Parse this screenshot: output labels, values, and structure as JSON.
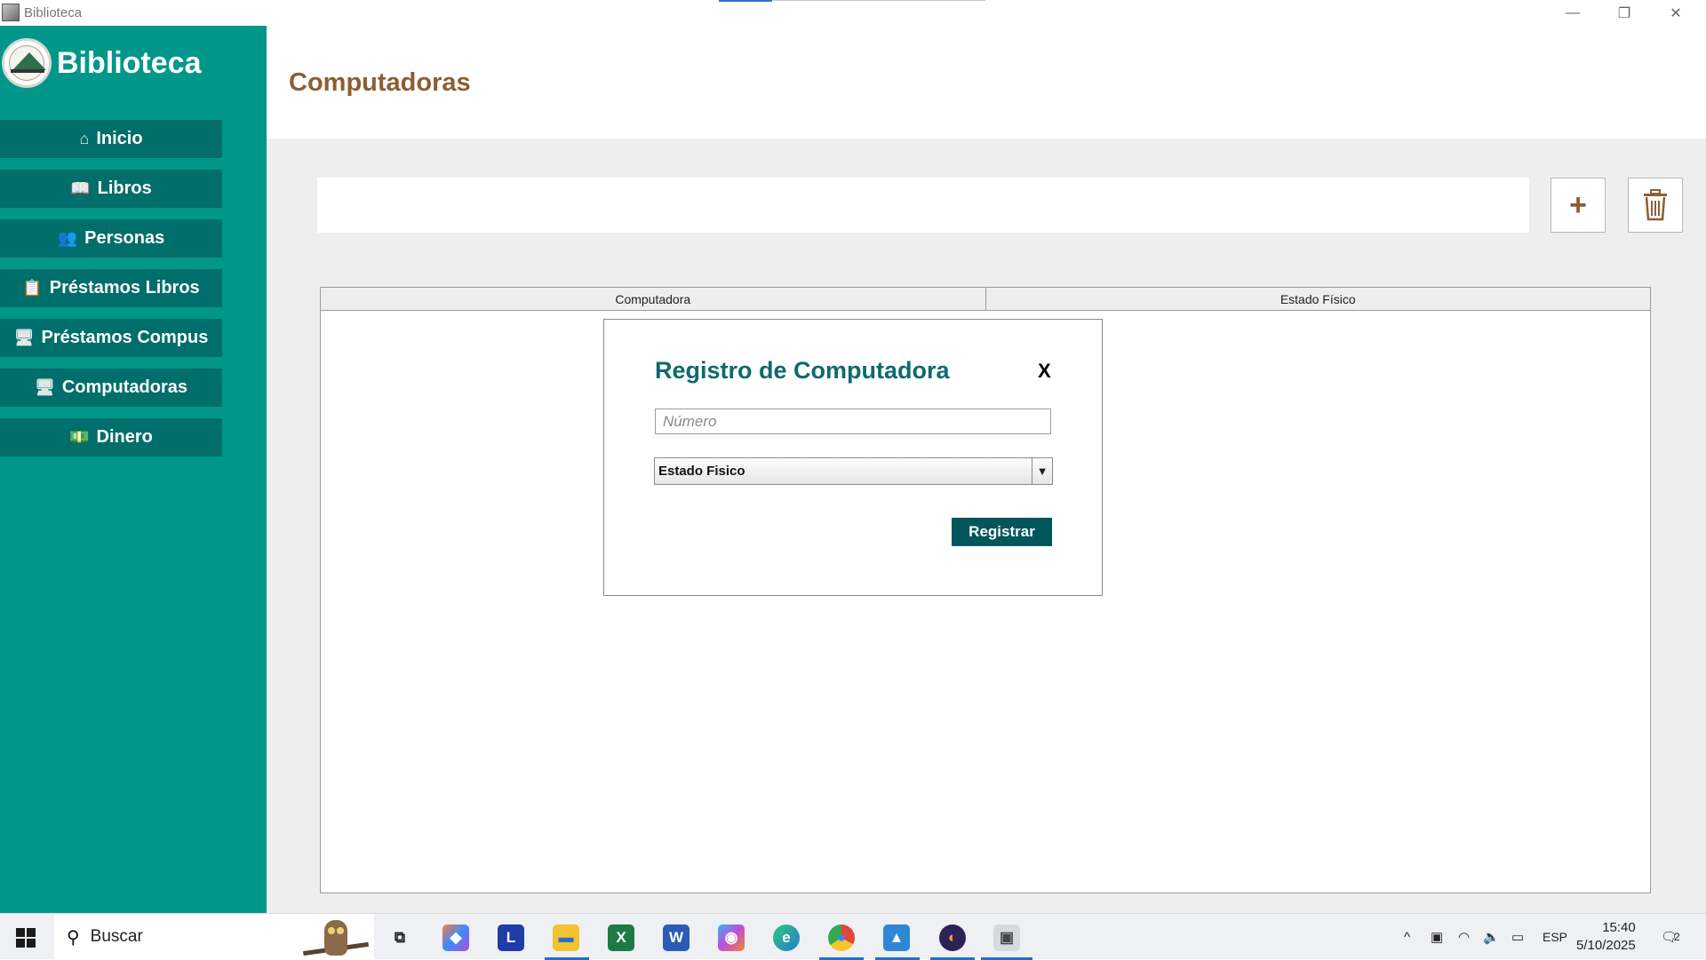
{
  "window": {
    "title": "Biblioteca",
    "minimize": "—",
    "restore": "❐",
    "close": "✕"
  },
  "brand": {
    "name": "Biblioteca"
  },
  "sidebar": {
    "items": [
      {
        "label": "Inicio",
        "icon": "home-icon",
        "glyph": "⌂"
      },
      {
        "label": "Libros",
        "icon": "book-icon",
        "glyph": "📖"
      },
      {
        "label": "Personas",
        "icon": "people-icon",
        "glyph": "👥"
      },
      {
        "label": "Préstamos Libros",
        "icon": "clipboard-icon",
        "glyph": "📋"
      },
      {
        "label": "Préstamos Compus",
        "icon": "monitor-icon",
        "glyph": "🖥"
      },
      {
        "label": "Computadoras",
        "icon": "monitor-icon",
        "glyph": "🖥"
      },
      {
        "label": "Dinero",
        "icon": "money-icon",
        "glyph": "💵"
      }
    ],
    "color": "#00978a",
    "item_color": "#006e6a"
  },
  "page": {
    "title": "Computadoras",
    "title_color": "#8c5e35",
    "add_glyph": "+",
    "trash_glyph": "🗑"
  },
  "table": {
    "columns": [
      "Computadora",
      "Estado Físico"
    ]
  },
  "dialog": {
    "title": "Registro de Computadora",
    "close_label": "X",
    "number_placeholder": "Número",
    "estado_select": "Estado Fisico",
    "select_arrow": "▼",
    "submit_label": "Registrar",
    "title_color": "#0e6a6d",
    "button_color": "#00565b"
  },
  "taskbar": {
    "search_label": "Buscar",
    "search_glyph": "⚲",
    "apps": [
      {
        "name": "task-view-icon",
        "glyph": "⧉"
      },
      {
        "name": "copilot-icon",
        "glyph": "◆"
      },
      {
        "name": "l-app-icon",
        "glyph": "L"
      },
      {
        "name": "file-explorer-icon",
        "glyph": "▬"
      },
      {
        "name": "excel-icon",
        "glyph": "X"
      },
      {
        "name": "word-icon",
        "glyph": "W"
      },
      {
        "name": "m365-icon",
        "glyph": "◉"
      },
      {
        "name": "edge-icon",
        "glyph": "e"
      },
      {
        "name": "chrome-icon",
        "glyph": "●"
      },
      {
        "name": "photos-icon",
        "glyph": "▲"
      },
      {
        "name": "eclipse-icon",
        "glyph": "◐"
      },
      {
        "name": "biblioteca-app-icon",
        "glyph": "▣"
      }
    ],
    "tray": {
      "chevron": "^",
      "language": "ESP",
      "time": "15:40",
      "date": "5/10/2025",
      "notifications": "2"
    }
  }
}
